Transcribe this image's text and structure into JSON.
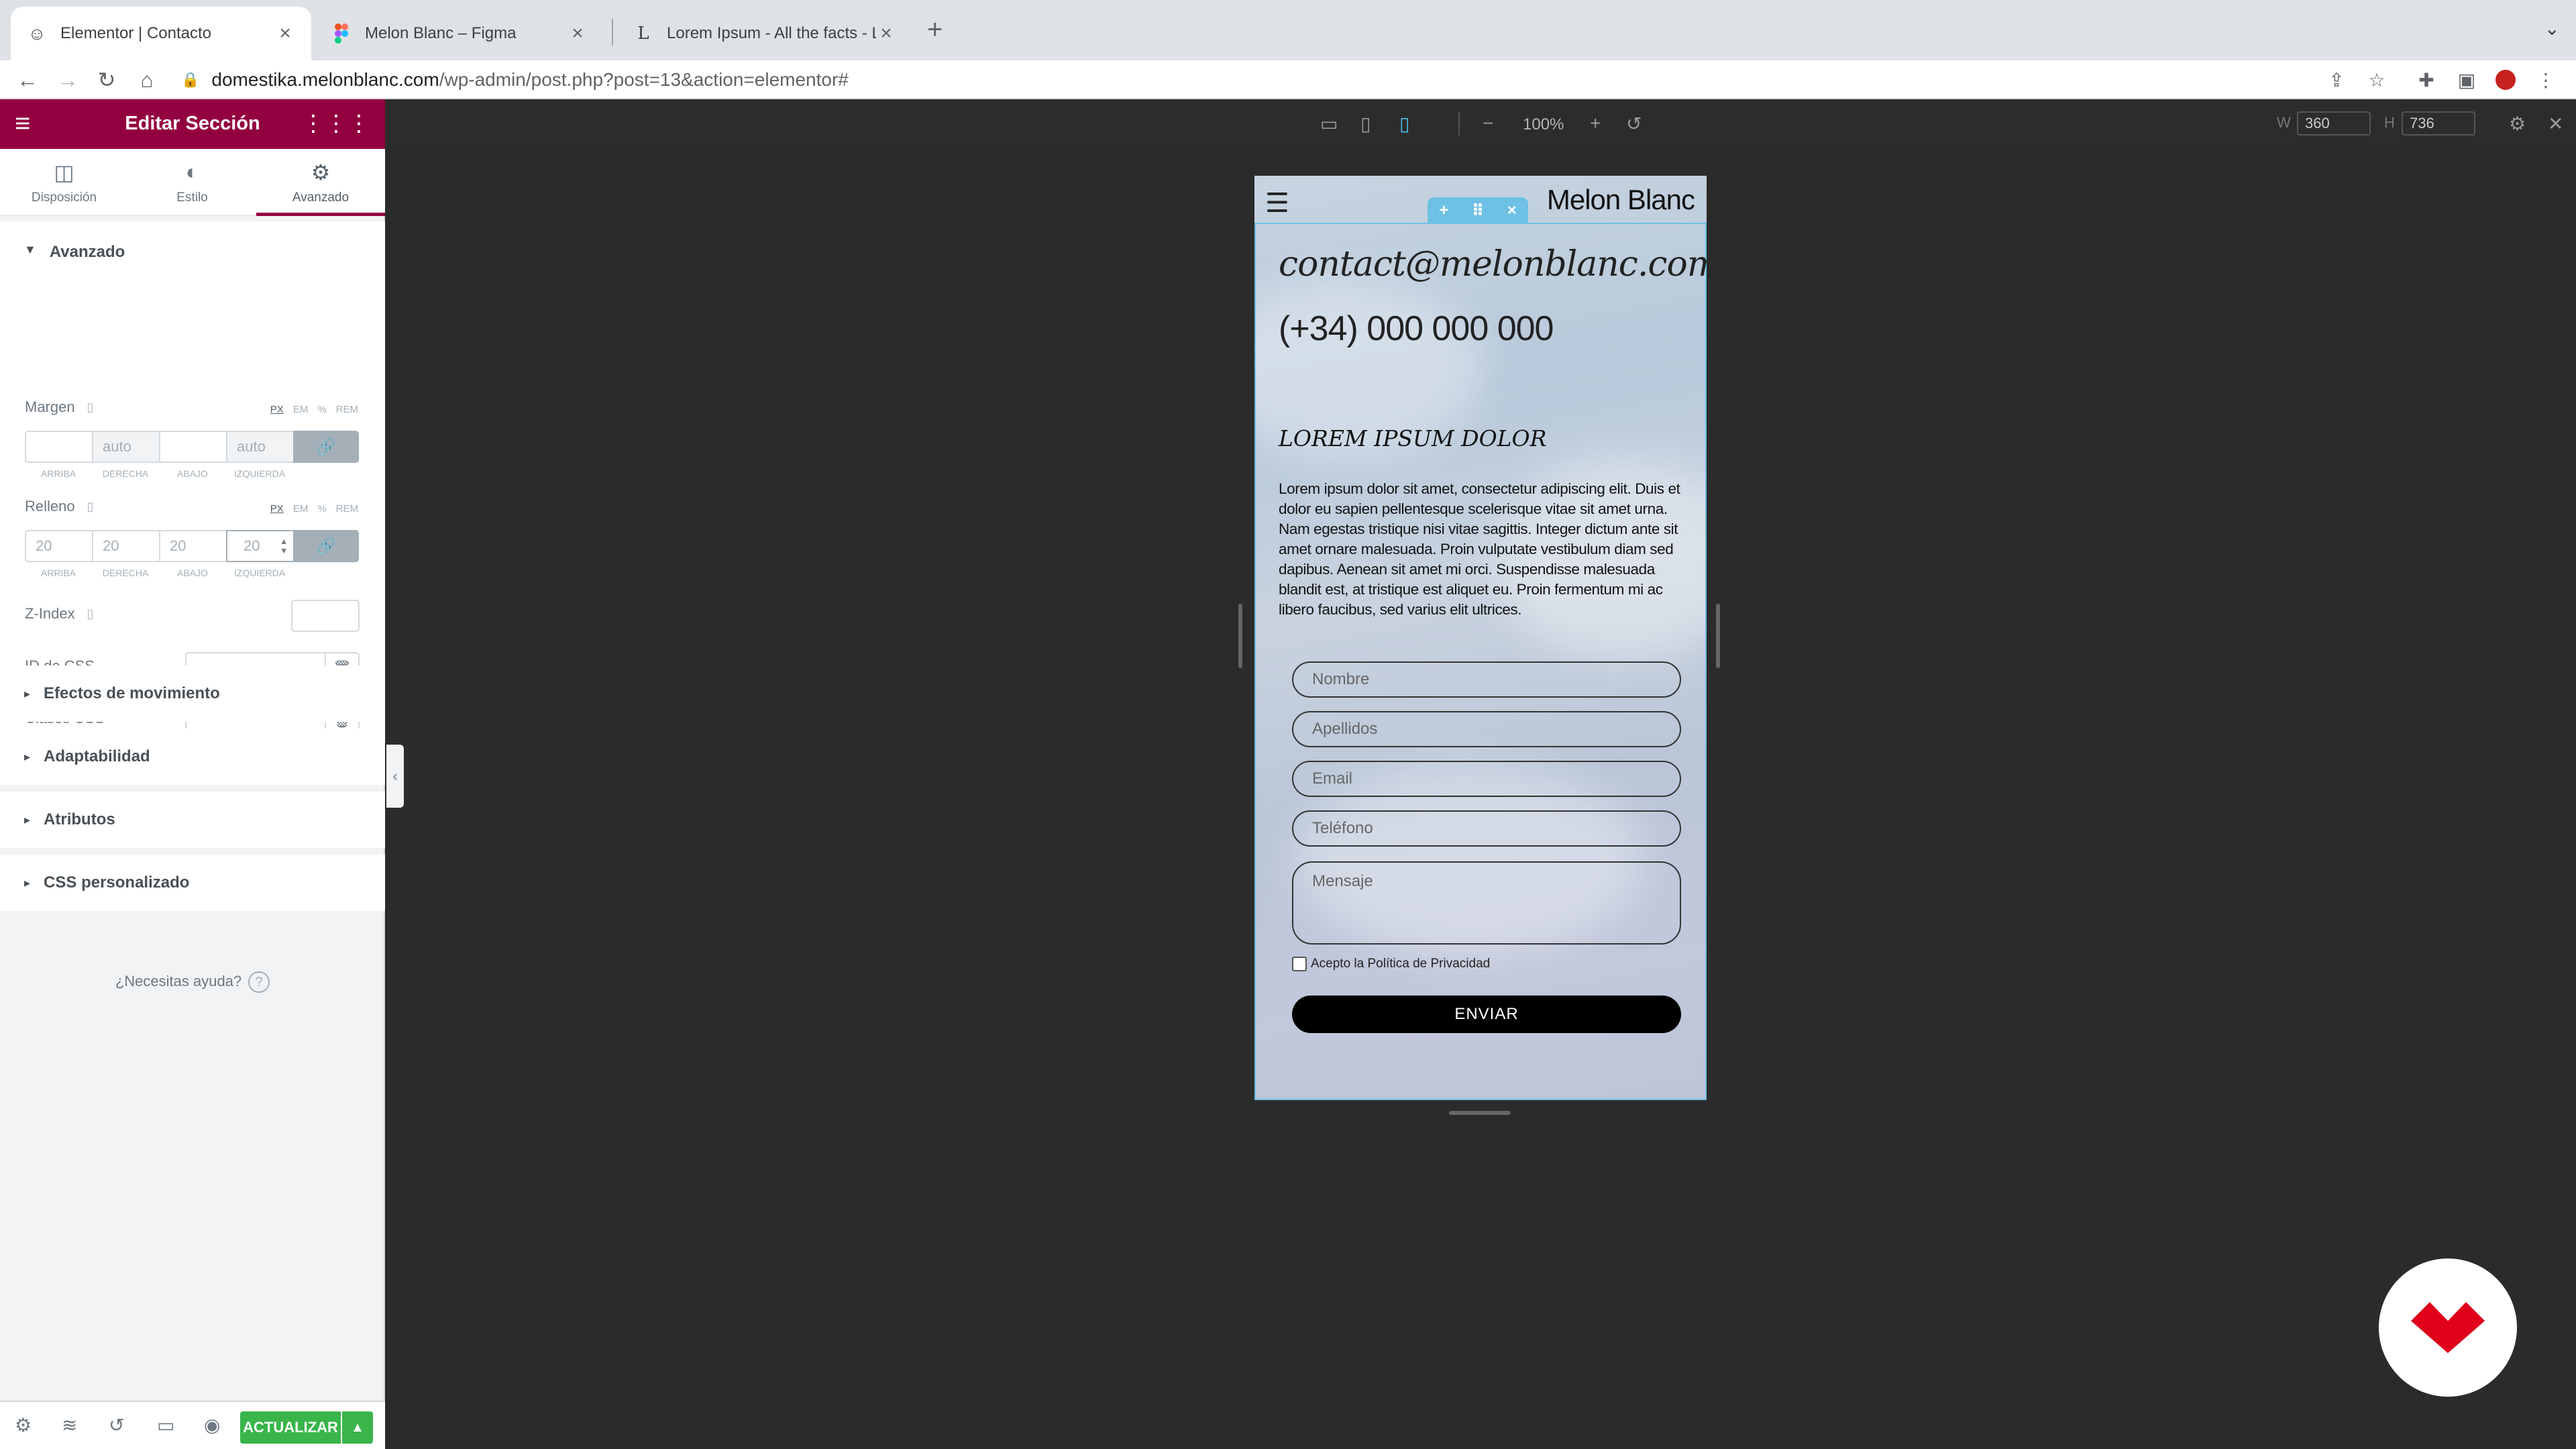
{
  "browser": {
    "tabs": [
      {
        "title": "Elementor | Contacto",
        "icon": "elementor-icon",
        "active": true
      },
      {
        "title": "Melon Blanc – Figma",
        "icon": "figma-icon",
        "active": false
      },
      {
        "title": "Lorem Ipsum - All the facts - Li",
        "icon": "lipsum-icon",
        "active": false
      }
    ],
    "url_host": "domestika.melonblanc.com",
    "url_path": "/wp-admin/post.php?post=13&action=elementor#"
  },
  "panel": {
    "title": "Editar Sección",
    "tabs": [
      "Disposición",
      "Estilo",
      "Avanzado"
    ],
    "advanced_title": "Avanzado",
    "margin": {
      "label": "Margen",
      "units": [
        "PX",
        "EM",
        "%",
        "REM"
      ],
      "values": [
        "",
        "auto",
        "",
        "auto"
      ],
      "sides": [
        "ARRIBA",
        "DERECHA",
        "ABAJO",
        "IZQUIERDA"
      ]
    },
    "padding": {
      "label": "Relleno",
      "units": [
        "PX",
        "EM",
        "%",
        "REM"
      ],
      "values": [
        "20",
        "20",
        "20",
        "20"
      ],
      "sides": [
        "ARRIBA",
        "DERECHA",
        "ABAJO",
        "IZQUIERDA"
      ]
    },
    "zindex_label": "Z-Index",
    "css_id_label": "ID de CSS",
    "css_classes_label": "Clases CSS",
    "collapsed_sections": [
      "Efectos de movimiento",
      "Adaptabilidad",
      "Atributos",
      "CSS personalizado"
    ],
    "help_text": "¿Necesitas ayuda?",
    "update_label": "ACTUALIZAR"
  },
  "editor_bar": {
    "zoom": "100%",
    "width_label": "W",
    "width_value": "360",
    "height_label": "H",
    "height_value": "736"
  },
  "preview": {
    "brand": "Melon Blanc",
    "email": "contact@melonblanc.com",
    "phone": "(+34) 000 000 000",
    "heading": "LOREM IPSUM DOLOR",
    "body": "Lorem ipsum dolor sit amet, consectetur adipiscing elit. Duis et dolor eu sapien pellentesque scelerisque vitae sit amet urna. Nam egestas tristique nisi vitae sagittis. Integer dictum ante sit amet ornare malesuada. Proin vulputate vestibulum diam sed dapibus. Aenean sit amet mi orci. Suspendisse malesuada blandit est, at tristique est aliquet eu. Proin fermentum mi ac libero faucibus, sed varius elit ultrices.",
    "fields": [
      "Nombre",
      "Apellidos",
      "Email",
      "Teléfono"
    ],
    "message_placeholder": "Mensaje",
    "privacy": "Acepto la Política de Privacidad",
    "submit": "ENVIAR"
  },
  "colors": {
    "elementor_brand": "#93003f",
    "update_green": "#39b54a",
    "section_outline": "#6ec1e4",
    "domestika_red": "#e0001b"
  }
}
